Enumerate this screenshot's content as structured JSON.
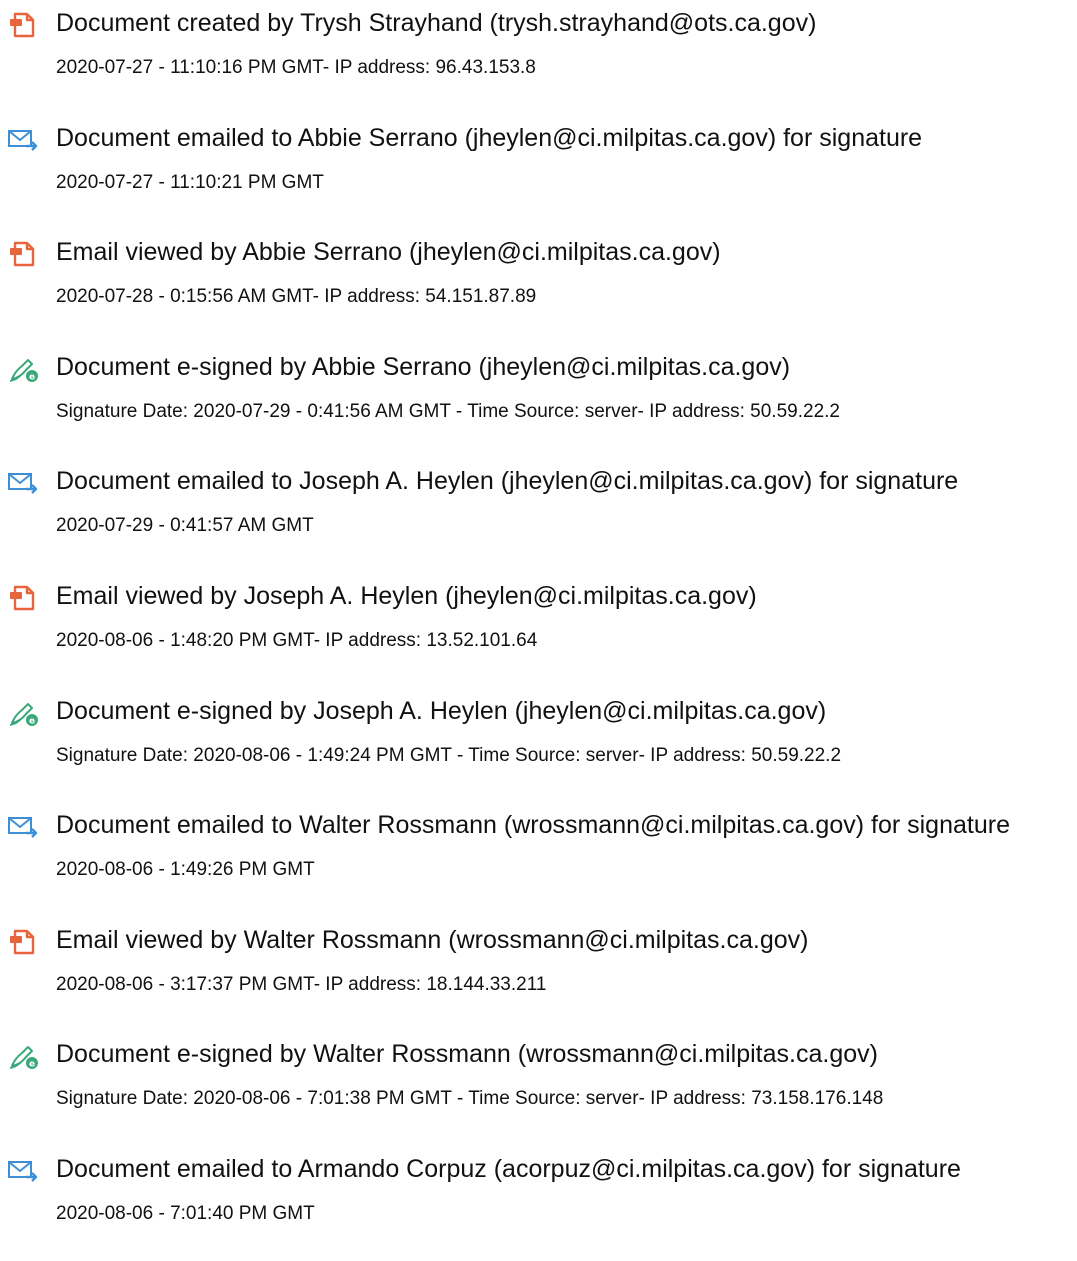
{
  "colors": {
    "document_icon": "#e8643c",
    "email_icon": "#3d8fd6",
    "sign_icon": "#3aa87a",
    "text": "#111111"
  },
  "events": [
    {
      "icon": "document-icon",
      "title": "Document created by Trysh Strayhand (trysh.strayhand@ots.ca.gov)",
      "detail": "2020-07-27 - 11:10:16 PM GMT- IP address: 96.43.153.8"
    },
    {
      "icon": "email-sent-icon",
      "title": "Document emailed to Abbie Serrano (jheylen@ci.milpitas.ca.gov) for signature",
      "detail": "2020-07-27 - 11:10:21 PM GMT"
    },
    {
      "icon": "document-icon",
      "title": "Email viewed by Abbie Serrano (jheylen@ci.milpitas.ca.gov)",
      "detail": "2020-07-28 - 0:15:56 AM GMT- IP address: 54.151.87.89"
    },
    {
      "icon": "esign-icon",
      "title": "Document e-signed by Abbie Serrano (jheylen@ci.milpitas.ca.gov)",
      "detail": "Signature Date: 2020-07-29 - 0:41:56 AM GMT - Time Source: server- IP address: 50.59.22.2"
    },
    {
      "icon": "email-sent-icon",
      "title": "Document emailed to Joseph A. Heylen (jheylen@ci.milpitas.ca.gov) for signature",
      "detail": "2020-07-29 - 0:41:57 AM GMT"
    },
    {
      "icon": "document-icon",
      "title": "Email viewed by Joseph A. Heylen (jheylen@ci.milpitas.ca.gov)",
      "detail": "2020-08-06 - 1:48:20 PM GMT- IP address: 13.52.101.64"
    },
    {
      "icon": "esign-icon",
      "title": "Document e-signed by Joseph A. Heylen (jheylen@ci.milpitas.ca.gov)",
      "detail": "Signature Date: 2020-08-06 - 1:49:24 PM GMT - Time Source: server- IP address: 50.59.22.2"
    },
    {
      "icon": "email-sent-icon",
      "title": "Document emailed to Walter Rossmann (wrossmann@ci.milpitas.ca.gov) for signature",
      "detail": "2020-08-06 - 1:49:26 PM GMT"
    },
    {
      "icon": "document-icon",
      "title": "Email viewed by Walter Rossmann (wrossmann@ci.milpitas.ca.gov)",
      "detail": "2020-08-06 - 3:17:37 PM GMT- IP address: 18.144.33.211"
    },
    {
      "icon": "esign-icon",
      "title": "Document e-signed by Walter Rossmann (wrossmann@ci.milpitas.ca.gov)",
      "detail": "Signature Date: 2020-08-06 - 7:01:38 PM GMT - Time Source: server- IP address: 73.158.176.148"
    },
    {
      "icon": "email-sent-icon",
      "title": "Document emailed to Armando Corpuz (acorpuz@ci.milpitas.ca.gov) for signature",
      "detail": "2020-08-06 - 7:01:40 PM GMT"
    }
  ]
}
